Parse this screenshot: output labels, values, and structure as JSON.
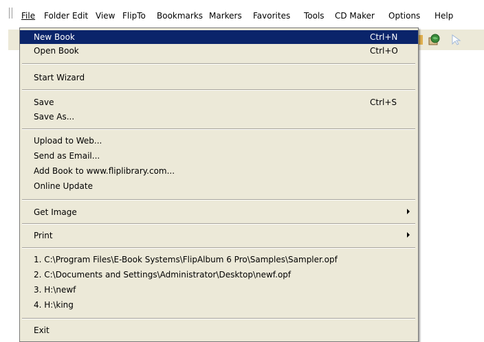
{
  "menubar": {
    "items": [
      {
        "label": "File",
        "mnemonic": "F"
      },
      {
        "label": "Folder",
        "mnemonic": "d"
      },
      {
        "label": "Edit",
        "mnemonic": "E"
      },
      {
        "label": "View",
        "mnemonic": "V"
      },
      {
        "label": "FlipTo",
        "mnemonic": "i"
      },
      {
        "label": "Bookmarks",
        "mnemonic": "B"
      },
      {
        "label": "Markers",
        "mnemonic": "M"
      },
      {
        "label": "Favorites",
        "mnemonic": "o"
      },
      {
        "label": "Tools",
        "mnemonic": "T"
      },
      {
        "label": "CD Maker",
        "mnemonic": "M"
      },
      {
        "label": "Options",
        "mnemonic": "O"
      },
      {
        "label": "Help",
        "mnemonic": "H"
      }
    ]
  },
  "file_menu": {
    "new_book": {
      "label": "New Book",
      "shortcut": "Ctrl+N"
    },
    "open_book": {
      "label": "Open Book",
      "shortcut": "Ctrl+O"
    },
    "start_wizard": {
      "label": "Start Wizard"
    },
    "save": {
      "label": "Save",
      "shortcut": "Ctrl+S"
    },
    "save_as": {
      "label": "Save As..."
    },
    "upload_to_web": {
      "label": "Upload to Web..."
    },
    "send_as_email": {
      "label": "Send as Email..."
    },
    "add_book_flip": {
      "label": "Add Book to www.fliplibrary.com..."
    },
    "online_update": {
      "label": "Online Update"
    },
    "get_image": {
      "label": "Get Image"
    },
    "print": {
      "label": "Print"
    },
    "recent": [
      "1. C:\\Program Files\\E-Book Systems\\FlipAlbum 6 Pro\\Samples\\Sampler.opf",
      "2. C:\\Documents and Settings\\Administrator\\Desktop\\newf.opf",
      "3. H:\\newf",
      "4. H:\\king"
    ],
    "exit": {
      "label": "Exit"
    }
  },
  "colors": {
    "menu_bg": "#ece9d8",
    "highlight": "#0a246a",
    "highlight_text": "#ffffff"
  }
}
